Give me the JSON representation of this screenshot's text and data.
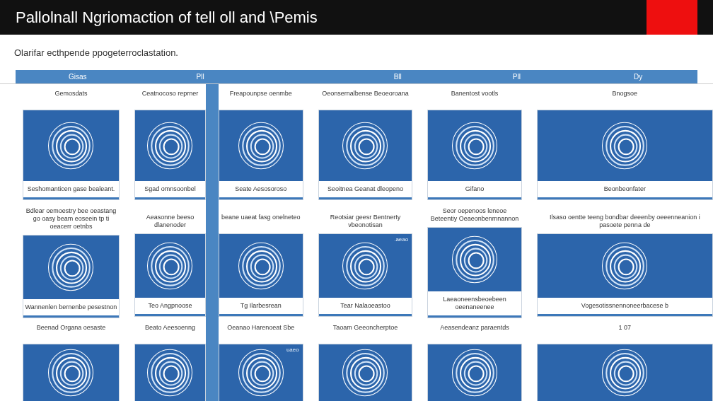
{
  "window": {
    "title": "Pallolnall Ngriomaction of tell oll and \\Pemis"
  },
  "subtitle": "Olarifar ecthpende ppogeterroclastation.",
  "header_bar": {
    "labels": [
      "Gisas",
      "Pll",
      "Bll",
      "Pll",
      "Dy"
    ]
  },
  "columns": [
    {
      "cards": [
        {
          "heading": "Gemosdats",
          "caption": "Seshomanticen gase bealeant."
        },
        {
          "heading": "Bdlear oemoestry bee oeastang go oasy beam eoseein tp ti oeacerr oetnbs",
          "caption": "Wannenlen bernenbe pesestnon"
        },
        {
          "heading": "Beenad Organa oesaste"
        }
      ]
    },
    {
      "cards": [
        {
          "heading": "Ceatnocoso reprner",
          "caption": "Sgad omnsoonbel"
        },
        {
          "heading": "Aeasonne beeso dlanenoder",
          "caption": "Teo Angpnoose"
        },
        {
          "heading": "Beato Aeesoenng"
        }
      ]
    },
    {
      "cards": [
        {
          "heading": "Freapounpse oenmbe",
          "caption": "Seate Aesosoroso"
        },
        {
          "heading": "beane uaeat fasg onelneteo",
          "caption": "Tg Ilarbesrean"
        },
        {
          "heading": "Oeanao Harenoeat Sbe",
          "image_label": "uaeo"
        }
      ]
    },
    {
      "cards": [
        {
          "heading": "Oeonsernalbense Beoeoroana",
          "caption": "Seoitnea Geanat dleopeno"
        },
        {
          "heading": "Reotsiar geesr Bentnerty vbeonotisan",
          "caption": "Tear Nalaoeastoo",
          "image_label": ".aeao"
        },
        {
          "heading": "Taoam Geeoncherptoe"
        }
      ]
    },
    {
      "cards": [
        {
          "heading": "Banentost vootls",
          "caption": "Gifano"
        },
        {
          "heading": "Seor oepenoos leneoe Beteentiy Oeaeonbenmnannon",
          "caption": "Laeaoneensbeoebeen oeenaneenee"
        },
        {
          "heading": "Aeasendeanz paraentds"
        }
      ]
    },
    {
      "cards": [
        {
          "heading": "Bnogsoe",
          "caption": "Beonbeonfater"
        },
        {
          "heading": "Ilsaso oentte teeng bondbar deeenby oeeenneanion i pasoete penna de",
          "caption": "Vogesotissnennoneerbacese b"
        },
        {
          "heading": "1 07"
        }
      ]
    }
  ]
}
